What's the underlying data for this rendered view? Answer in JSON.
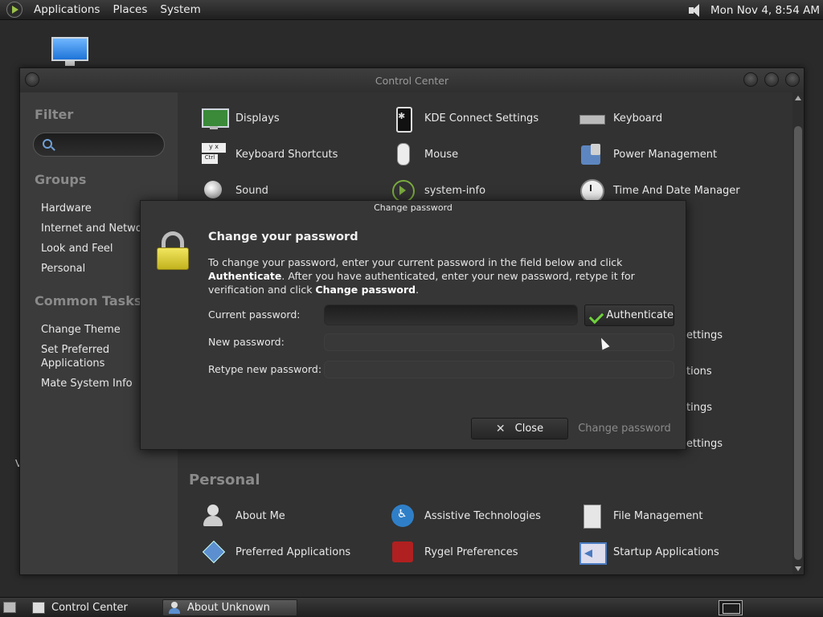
{
  "top_panel": {
    "menus": [
      "Applications",
      "Places",
      "System"
    ],
    "clock": "Mon Nov  4,  8:54 AM"
  },
  "desktop": {
    "glyph": "V"
  },
  "control_center": {
    "title": "Control Center",
    "sidebar": {
      "filter_heading": "Filter",
      "filter_value": "",
      "groups_heading": "Groups",
      "groups": [
        "Hardware",
        "Internet and Network",
        "Look and Feel",
        "Personal"
      ],
      "tasks_heading": "Common Tasks",
      "tasks": [
        "Change Theme",
        "Set Preferred Applications",
        "Mate System Info"
      ]
    },
    "items_top": [
      {
        "label": "Displays",
        "icon": "display-icon"
      },
      {
        "label": "KDE Connect Settings",
        "icon": "phone-icon"
      },
      {
        "label": "Keyboard",
        "icon": "keyboard-icon"
      },
      {
        "label": "Keyboard Shortcuts",
        "icon": "shortcut-icon"
      },
      {
        "label": "Mouse",
        "icon": "mouse-icon"
      },
      {
        "label": "Power Management",
        "icon": "power-icon"
      },
      {
        "label": "Sound",
        "icon": "sound-icon"
      },
      {
        "label": "system-info",
        "icon": "system-info-icon"
      },
      {
        "label": "Time And Date Manager",
        "icon": "clock-icon"
      }
    ],
    "partial_labels": [
      "ettings",
      "tions",
      "tings",
      "ettings"
    ],
    "personal_heading": "Personal",
    "items_personal": [
      {
        "label": "About Me",
        "icon": "about-me-icon"
      },
      {
        "label": "Assistive Technologies",
        "icon": "accessibility-icon"
      },
      {
        "label": "File Management",
        "icon": "file-cabinet-icon"
      },
      {
        "label": "Preferred Applications",
        "icon": "preferred-apps-icon"
      },
      {
        "label": "Rygel Preferences",
        "icon": "rygel-icon"
      },
      {
        "label": "Startup Applications",
        "icon": "startup-icon"
      }
    ]
  },
  "dialog": {
    "title": "Change password",
    "heading": "Change your password",
    "desc_1": "To change your password, enter your current password in the field below and click ",
    "desc_bold_1": "Authenticate",
    "desc_2": ". After you have authenticated, enter your new password, retype it for verification and click ",
    "desc_bold_2": "Change password",
    "desc_3": ".",
    "current_label": "Current password:",
    "new_label": "New password:",
    "retype_label": "Retype new password:",
    "current_value": "",
    "authenticate_label": "Authenticate",
    "close_label": "Close",
    "change_label": "Change password"
  },
  "taskbar": {
    "tasks": [
      "Control Center",
      "About Unknown"
    ]
  }
}
